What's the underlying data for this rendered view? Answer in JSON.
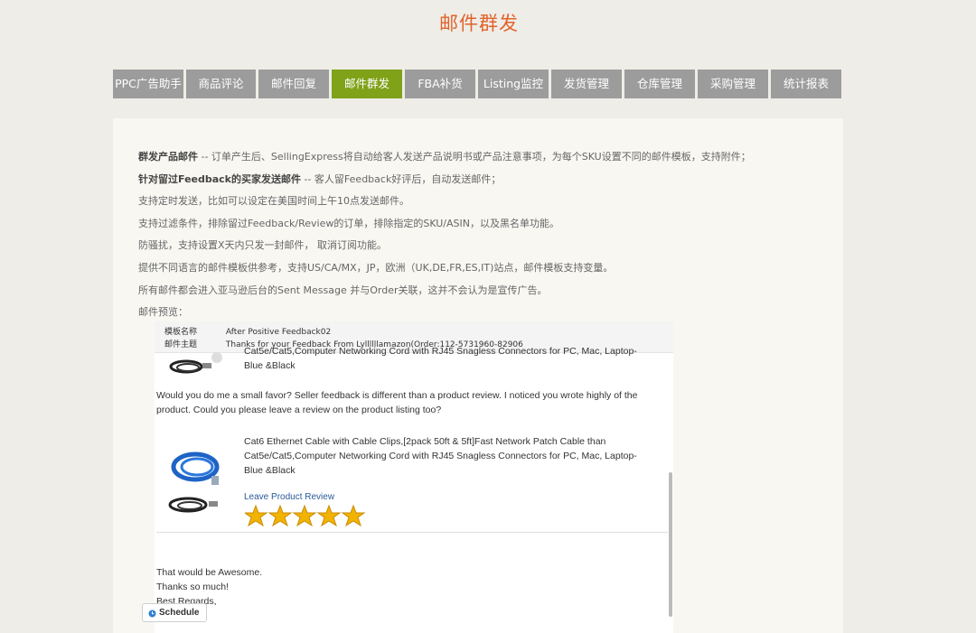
{
  "page_title": "邮件群发",
  "tabs": [
    {
      "label": "PPC广告助手"
    },
    {
      "label": "商品评论"
    },
    {
      "label": "邮件回复"
    },
    {
      "label": "邮件群发",
      "active": true
    },
    {
      "label": "FBA补货"
    },
    {
      "label": "Listing监控"
    },
    {
      "label": "发货管理"
    },
    {
      "label": "仓库管理"
    },
    {
      "label": "采购管理"
    },
    {
      "label": "统计报表"
    }
  ],
  "features": [
    {
      "bold": "群发产品邮件",
      "text": " -- 订单产生后、SellingExpress将自动给客人发送产品说明书或产品注意事项，为每个SKU设置不同的邮件模板，支持附件；"
    },
    {
      "bold": "针对留过Feedback的买家发送邮件",
      "text": " -- 客人留Feedback好评后，自动发送邮件；"
    },
    {
      "bold": "",
      "text": "支持定时发送，比如可以设定在美国时间上午10点发送邮件。"
    },
    {
      "bold": "",
      "text": "支持过滤条件，排除留过Feedback/Review的订单，排除指定的SKU/ASIN，以及黑名单功能。"
    },
    {
      "bold": "",
      "text": "防骚扰，支持设置X天内只发一封邮件， 取消订阅功能。"
    },
    {
      "bold": "",
      "text": "提供不同语言的邮件模板供参考，支持US/CA/MX，JP，欧洲（UK,DE,FR,ES,IT)站点，邮件模板支持变量。"
    },
    {
      "bold": "",
      "text": "所有邮件都会进入亚马逊后台的Sent Message 并与Order关联，这并不会认为是宣传广告。"
    },
    {
      "bold": "",
      "text": "邮件预览："
    }
  ],
  "preview": {
    "template_name_label": "模板名称",
    "template_name": "After Positive Feedback02",
    "subject_label": "邮件主题",
    "subject": "Thanks for your Feedback From Lyllllllamazon(Order:112-5731960-82906",
    "product1_text": "Cat5e/Cat5,Computer Networking Cord with RJ45 Snagless Connectors for PC, Mac, Laptop-Blue &Black",
    "ask_text": "Would you do me a small favor? Seller feedback is different than a product review. I noticed you wrote highly of the product. Could you please leave a review on the product listing too?",
    "product2_text": "Cat6 Ethernet Cable with Cable Clips,[2pack 50ft & 5ft]Fast Network Patch Cable than Cat5e/Cat5,Computer Networking Cord with RJ45 Snagless Connectors for PC, Mac, Laptop-Blue &Black",
    "review_link": "Leave Product Review",
    "rating": 5,
    "closing_1": "That would be Awesome.",
    "closing_2": "Thanks so much!",
    "closing_3": "Best Regards,"
  },
  "schedule_label": "Schedule",
  "colors": {
    "title": "#e2622b",
    "tab": "#9c9c9c",
    "tab_active": "#7fa219",
    "background": "#efede7",
    "panel": "#f8f7f2",
    "link": "#2a5a9a",
    "star": "#f2b300"
  },
  "icons": {
    "product_image_1": "ethernet-cable-black-icon",
    "product_image_2": "ethernet-cable-blue-icon",
    "star": "star-icon",
    "schedule": "clock-icon"
  }
}
